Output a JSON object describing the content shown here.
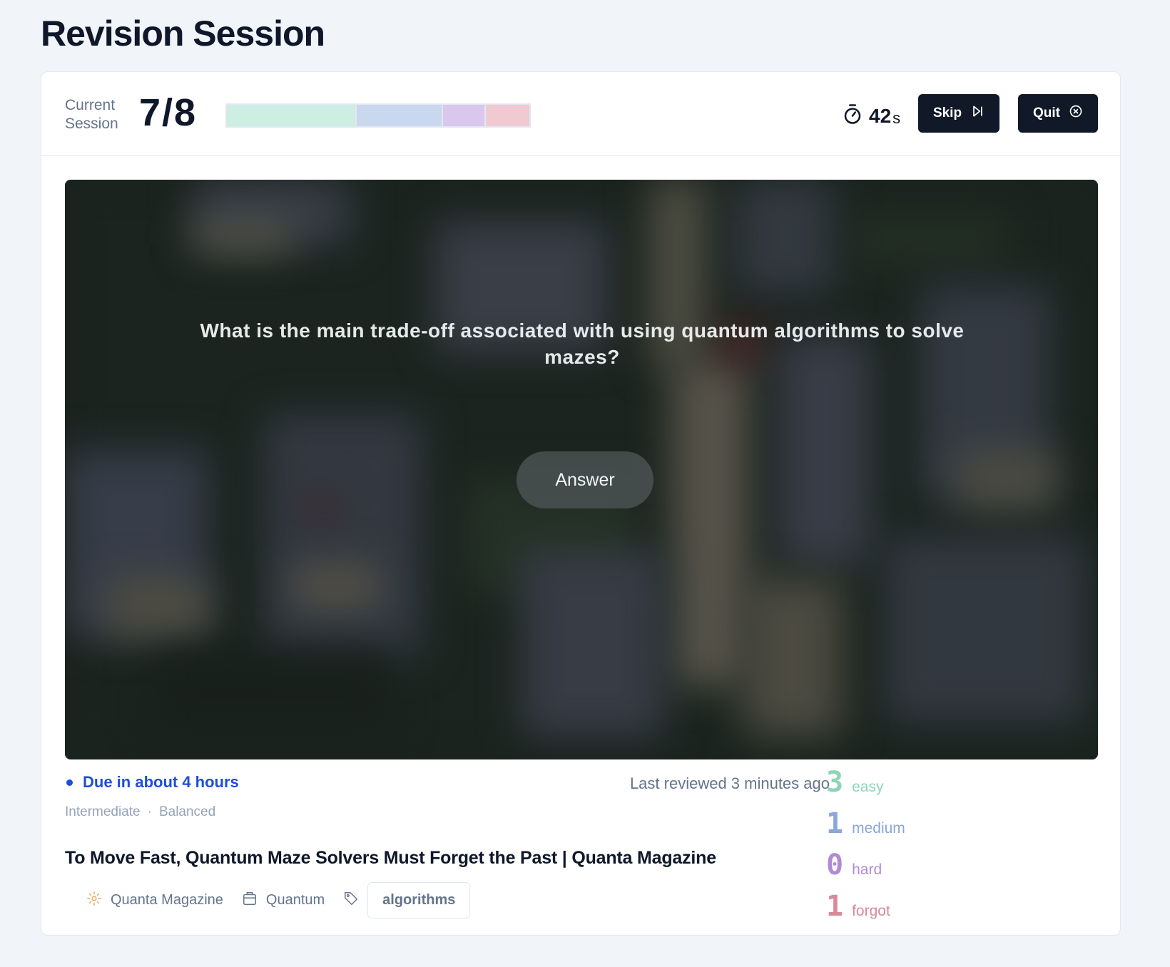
{
  "page": {
    "title": "Revision Session"
  },
  "session": {
    "label": "Current Session",
    "count": "7/8",
    "progress": [
      {
        "name": "easy",
        "fraction": 0.43,
        "color": "#cdeee2"
      },
      {
        "name": "medium",
        "fraction": 0.285,
        "color": "#c9d8ef"
      },
      {
        "name": "hard",
        "fraction": 0.14,
        "color": "#d9c7ee"
      },
      {
        "name": "forgot",
        "fraction": 0.145,
        "color": "#f0c9d2"
      }
    ]
  },
  "timer": {
    "value": "42",
    "unit": "s",
    "icon": "stopwatch-icon"
  },
  "actions": {
    "skip_label": "Skip",
    "skip_icon": "skip-forward-icon",
    "quit_label": "Quit",
    "quit_icon": "close-circle-icon"
  },
  "card": {
    "question": "What is the main trade-off associated with using quantum algorithms to solve mazes?",
    "answer_label": "Answer"
  },
  "schedule": {
    "due": "Due in about 4 hours",
    "last_reviewed": "Last reviewed 3 minutes ago",
    "difficulty": "Intermediate",
    "separator": "·",
    "mode": "Balanced"
  },
  "article": {
    "title": "To Move Fast, Quantum Maze Solvers Must Forget the Past | Quanta Magazine",
    "source": "Quanta Magazine",
    "category": "Quantum",
    "tag": "algorithms"
  },
  "stats": [
    {
      "count": "3",
      "label": "easy",
      "color": "#8fd4b8"
    },
    {
      "count": "1",
      "label": "medium",
      "color": "#8aa7d8"
    },
    {
      "count": "0",
      "label": "hard",
      "color": "#b18ad6"
    },
    {
      "count": "1",
      "label": "forgot",
      "color": "#d98a9a"
    }
  ]
}
